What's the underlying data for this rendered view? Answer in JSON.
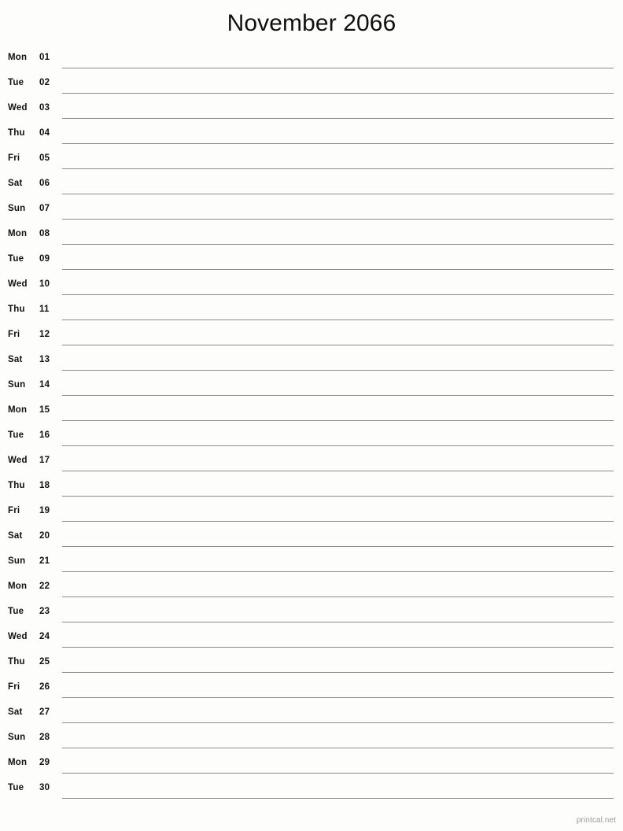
{
  "document": {
    "title": "November 2066",
    "month": "November",
    "year": "2066",
    "type": "printable-notes-calendar",
    "layout": "single-column-lined-list",
    "background_color": "#fdfdfb",
    "rule_color": "#8a8a8a",
    "text_color": "#111111"
  },
  "footer": {
    "credit": "printcal.net"
  },
  "days": [
    {
      "weekday": "Mon",
      "date": "01"
    },
    {
      "weekday": "Tue",
      "date": "02"
    },
    {
      "weekday": "Wed",
      "date": "03"
    },
    {
      "weekday": "Thu",
      "date": "04"
    },
    {
      "weekday": "Fri",
      "date": "05"
    },
    {
      "weekday": "Sat",
      "date": "06"
    },
    {
      "weekday": "Sun",
      "date": "07"
    },
    {
      "weekday": "Mon",
      "date": "08"
    },
    {
      "weekday": "Tue",
      "date": "09"
    },
    {
      "weekday": "Wed",
      "date": "10"
    },
    {
      "weekday": "Thu",
      "date": "11"
    },
    {
      "weekday": "Fri",
      "date": "12"
    },
    {
      "weekday": "Sat",
      "date": "13"
    },
    {
      "weekday": "Sun",
      "date": "14"
    },
    {
      "weekday": "Mon",
      "date": "15"
    },
    {
      "weekday": "Tue",
      "date": "16"
    },
    {
      "weekday": "Wed",
      "date": "17"
    },
    {
      "weekday": "Thu",
      "date": "18"
    },
    {
      "weekday": "Fri",
      "date": "19"
    },
    {
      "weekday": "Sat",
      "date": "20"
    },
    {
      "weekday": "Sun",
      "date": "21"
    },
    {
      "weekday": "Mon",
      "date": "22"
    },
    {
      "weekday": "Tue",
      "date": "23"
    },
    {
      "weekday": "Wed",
      "date": "24"
    },
    {
      "weekday": "Thu",
      "date": "25"
    },
    {
      "weekday": "Fri",
      "date": "26"
    },
    {
      "weekday": "Sat",
      "date": "27"
    },
    {
      "weekday": "Sun",
      "date": "28"
    },
    {
      "weekday": "Mon",
      "date": "29"
    },
    {
      "weekday": "Tue",
      "date": "30"
    }
  ]
}
